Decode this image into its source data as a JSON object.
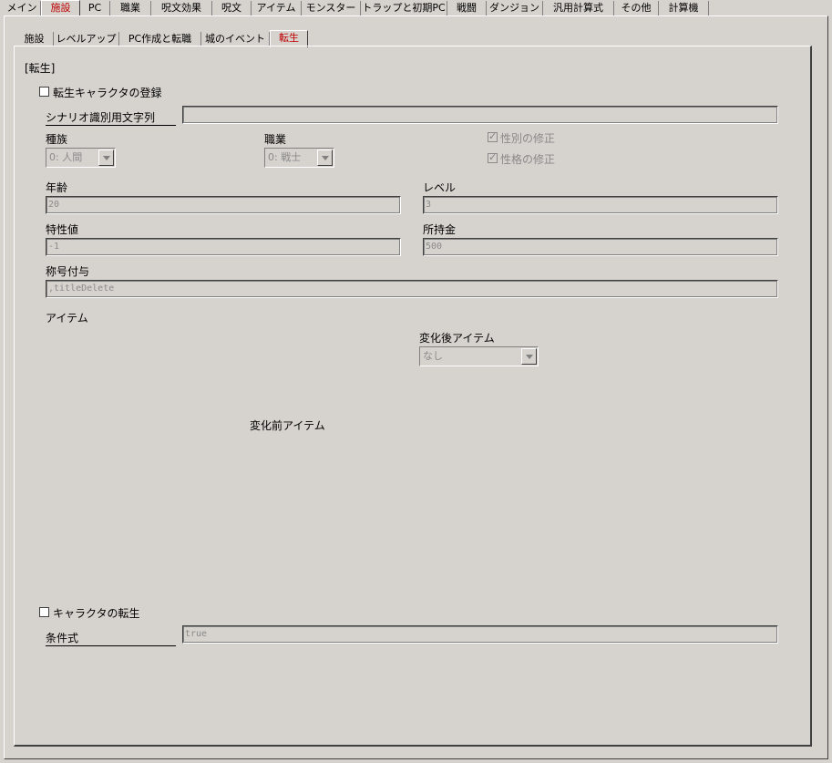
{
  "top_tabs": [
    "メイン",
    "施設",
    "PC",
    "職業",
    "呪文効果",
    "呪文",
    "アイテム",
    "モンスター",
    "トラップと初期PC",
    "戦闘",
    "ダンジョン",
    "汎用計算式",
    "その他",
    "計算機"
  ],
  "sub_tabs": [
    "施設",
    "レベルアップ",
    "PC作成と転職",
    "城のイベント",
    "転生"
  ],
  "section_title": "[転生]",
  "register_checkbox_label": "転生キャラクタの登録",
  "scenario_label": "シナリオ識別用文字列",
  "scenario_value": "",
  "race_label": "種族",
  "race_value": "0: 人間",
  "job_label": "職業",
  "job_value": "0: 戦士",
  "fix_gender_label": "性別の修正",
  "fix_personality_label": "性格の修正",
  "age_label": "年齢",
  "age_value": "20",
  "level_label": "レベル",
  "level_value": "3",
  "trait_label": "特性値",
  "trait_value": "-1",
  "gold_label": "所持金",
  "gold_value": "500",
  "title_label": "称号付与",
  "title_value": ",titleDelete",
  "item_label": "アイテム",
  "after_item_label": "変化後アイテム",
  "after_item_value": "なし",
  "before_item_label": "変化前アイテム",
  "reincarnate_checkbox_label": "キャラクタの転生",
  "condition_label": "条件式",
  "condition_value": "true"
}
